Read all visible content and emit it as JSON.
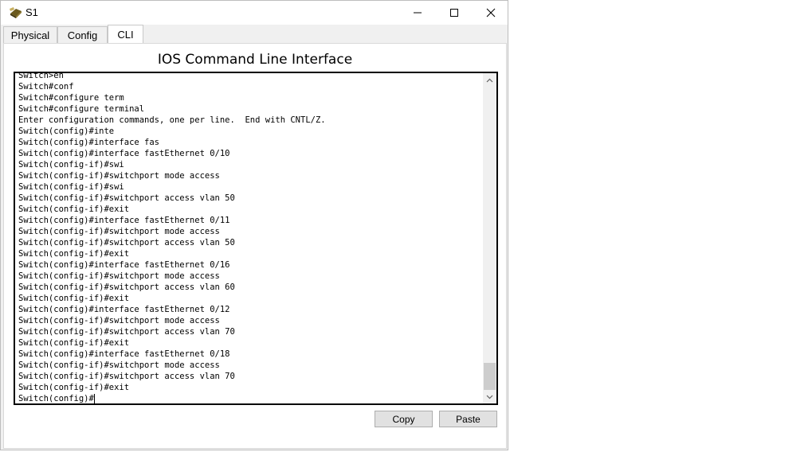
{
  "window": {
    "title": "S1"
  },
  "tabs": [
    {
      "label": "Physical"
    },
    {
      "label": "Config"
    },
    {
      "label": "CLI"
    }
  ],
  "active_tab": "CLI",
  "cli": {
    "heading": "IOS Command Line Interface",
    "lines": [
      "Switch>en",
      "Switch#conf",
      "Switch#configure term",
      "Switch#configure terminal",
      "Enter configuration commands, one per line.  End with CNTL/Z.",
      "Switch(config)#inte",
      "Switch(config)#interface fas",
      "Switch(config)#interface fastEthernet 0/10",
      "Switch(config-if)#swi",
      "Switch(config-if)#switchport mode access",
      "Switch(config-if)#swi",
      "Switch(config-if)#switchport access vlan 50",
      "Switch(config-if)#exit",
      "Switch(config)#interface fastEthernet 0/11",
      "Switch(config-if)#switchport mode access",
      "Switch(config-if)#switchport access vlan 50",
      "Switch(config-if)#exit",
      "Switch(config)#interface fastEthernet 0/16",
      "Switch(config-if)#switchport mode access",
      "Switch(config-if)#switchport access vlan 60",
      "Switch(config-if)#exit",
      "Switch(config)#interface fastEthernet 0/12",
      "Switch(config-if)#switchport mode access",
      "Switch(config-if)#switchport access vlan 70",
      "Switch(config-if)#exit",
      "Switch(config)#interface fastEthernet 0/18",
      "Switch(config-if)#switchport mode access",
      "Switch(config-if)#switchport access vlan 70",
      "Switch(config-if)#exit",
      "Switch(config)#"
    ],
    "scroll_position": 1.0
  },
  "buttons": {
    "copy": "Copy",
    "paste": "Paste"
  },
  "icons": {
    "app": "switch-icon",
    "minimize": "minimize-icon",
    "maximize": "maximize-icon",
    "close": "close-icon",
    "scroll_up": "chevron-up-icon",
    "scroll_down": "chevron-down-icon"
  }
}
